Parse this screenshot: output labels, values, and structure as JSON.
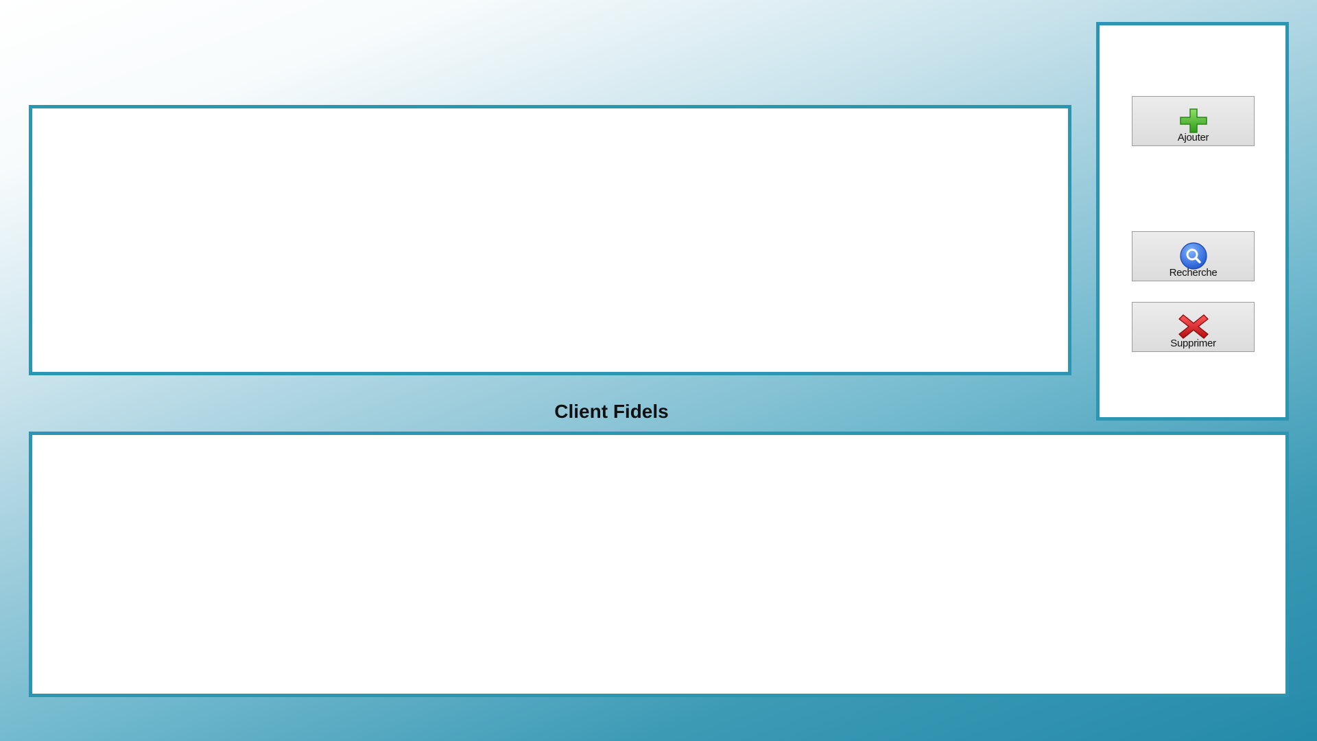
{
  "actions": {
    "add_label": "Ajouter",
    "search_label": "Recherche",
    "delete_label": "Supprimer"
  },
  "clients": {
    "title": "Client Fidels"
  },
  "icons": {
    "add": "plus-icon",
    "search": "magnifier-icon",
    "delete": "x-icon"
  },
  "colors": {
    "panel_border": "#2b95b2",
    "add_icon": "#4cbb2e",
    "search_icon": "#2f6fe0",
    "delete_icon": "#d3191c"
  }
}
